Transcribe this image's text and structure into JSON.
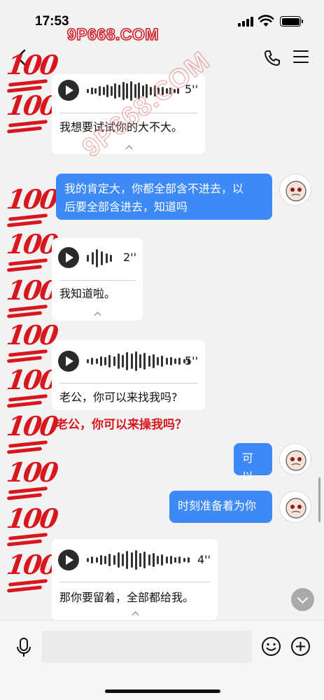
{
  "status_bar": {
    "time": "17:53"
  },
  "watermark": {
    "top": "9P668.COM",
    "diagonal": "9P668.COM"
  },
  "nav": {
    "back": "back",
    "call": "phone-icon",
    "menu": "menu-icon"
  },
  "sticker": {
    "label": "100"
  },
  "messages": [
    {
      "type": "voice",
      "duration": "5''",
      "transcript": "我想要试试你的大不大。"
    },
    {
      "type": "text",
      "side": "out",
      "lines": [
        "我的肯定大，你都全部含不进去，以",
        "后要全部含进去，知道吗"
      ]
    },
    {
      "type": "voice",
      "duration": "2''",
      "transcript": "我知道啦。"
    },
    {
      "type": "voice",
      "duration": "5''",
      "transcript": "老公，你可以来找我吗?"
    },
    {
      "type": "text",
      "side": "out",
      "text": "可以"
    },
    {
      "type": "text",
      "side": "out",
      "text": "时刻准备着为你"
    },
    {
      "type": "voice",
      "duration": "4''",
      "transcript": "那你要留着，全部都给我。"
    }
  ],
  "overlay_text": "老公，你可以来操我吗？",
  "composer": {
    "placeholder": ""
  },
  "colors": {
    "outgoing": "#3d8af7",
    "sticker_red": "#d8161d",
    "background": "#f2f2f2"
  }
}
